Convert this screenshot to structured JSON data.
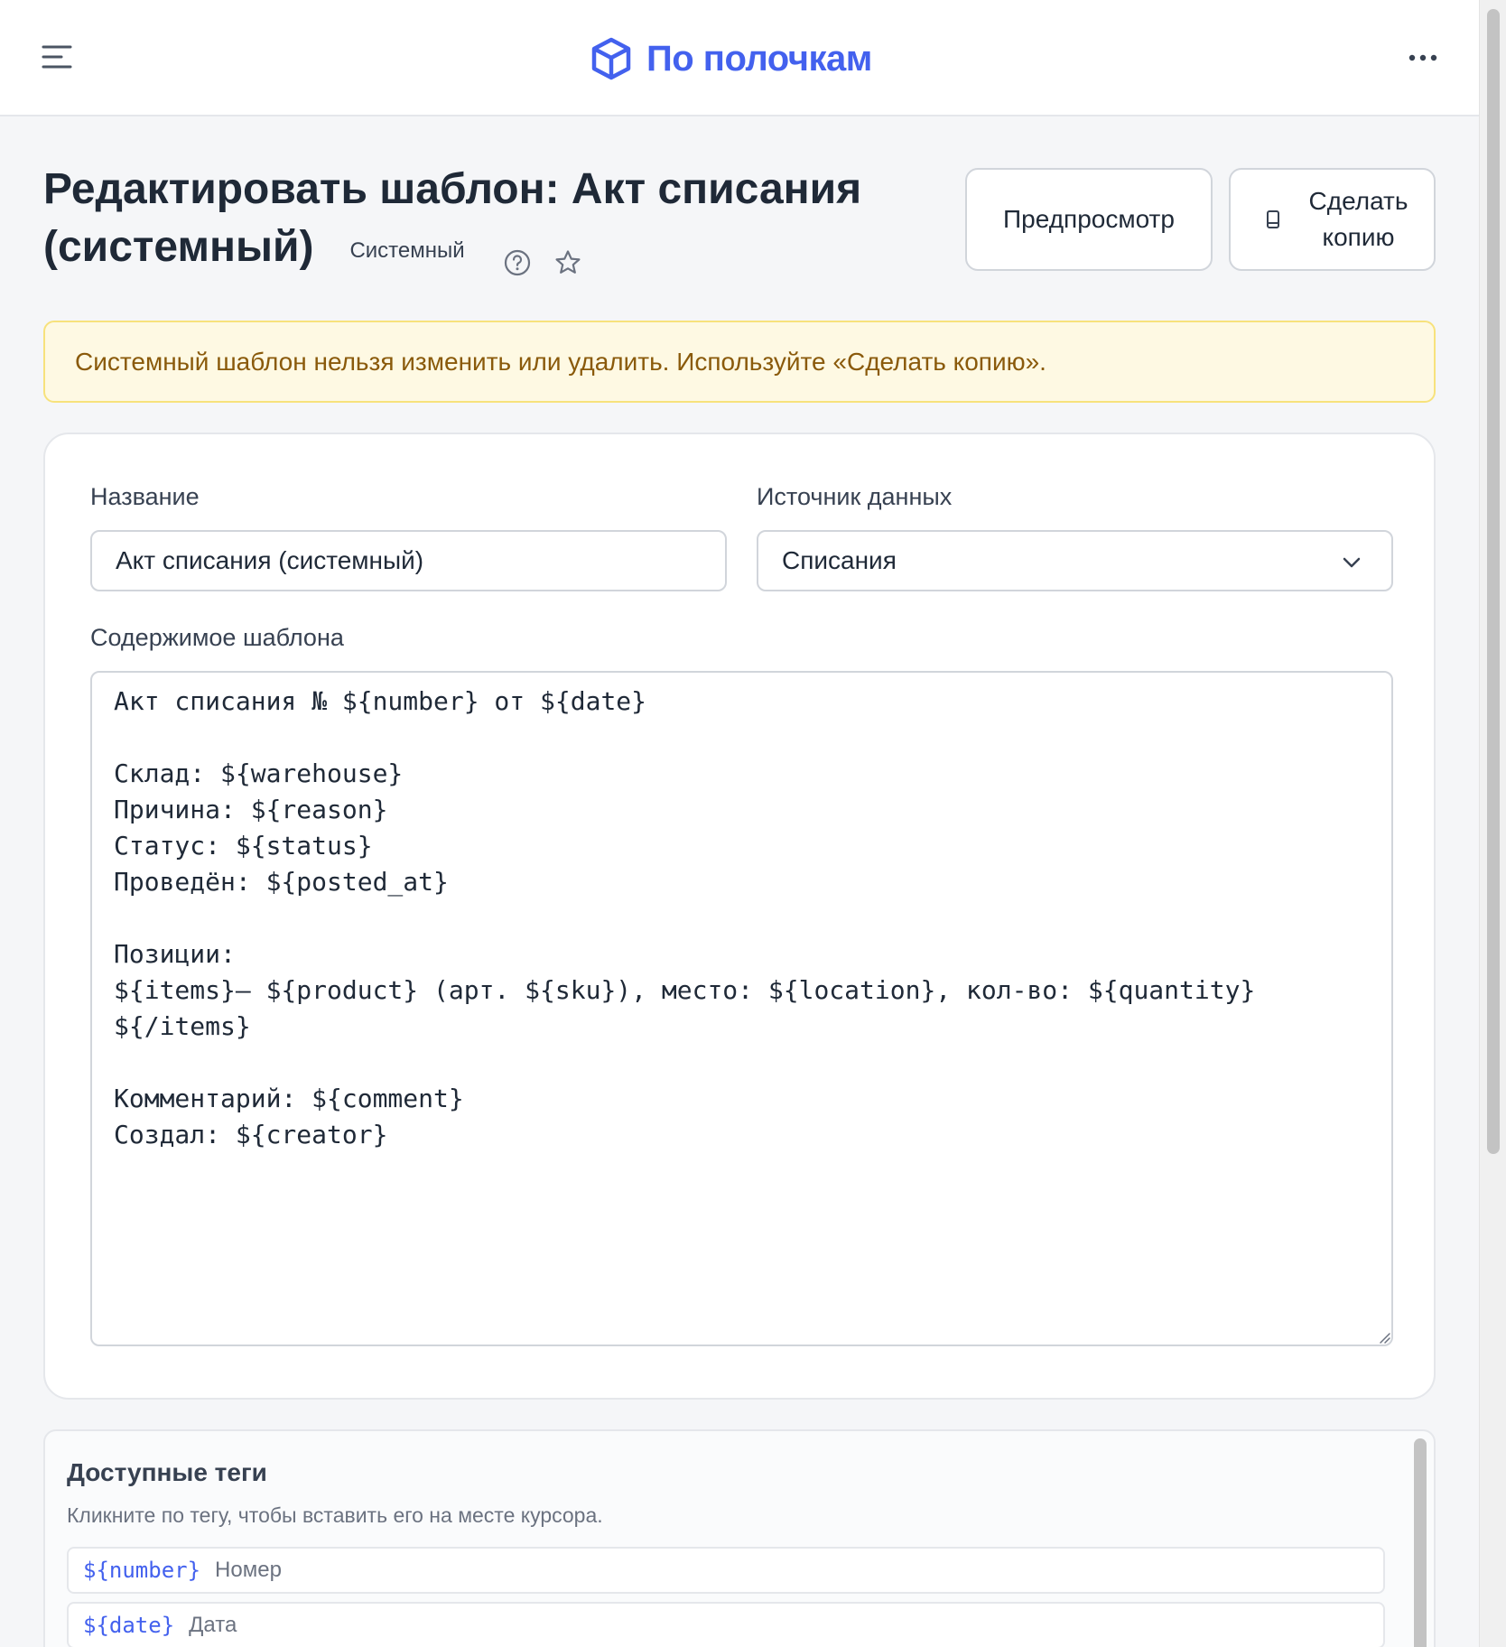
{
  "header": {
    "brand": "По полочкам",
    "brand_color": "#4361ee"
  },
  "page": {
    "title_line1": "Редактировать шаблон: Акт списания",
    "title_line2": "(системный)",
    "badge": "Системный",
    "preview_label": "Предпросмотр",
    "copy_label": "Сделать копию"
  },
  "alert": {
    "text": "Системный шаблон нельзя изменить или удалить. Используйте «Сделать копию»."
  },
  "form": {
    "name_label": "Название",
    "name_value": "Акт списания (системный)",
    "source_label": "Источник данных",
    "source_value": "Списания",
    "content_label": "Содержимое шаблона",
    "content_value": "Акт списания № ${number} от ${date}\n\nСклад: ${warehouse}\nПричина: ${reason}\nСтатус: ${status}\nПроведён: ${posted_at}\n\nПозиции:\n${items}— ${product} (арт. ${sku}), место: ${location}, кол-во: ${quantity}\n${/items}\n\nКомментарий: ${comment}\nСоздал: ${creator}"
  },
  "tags": {
    "title": "Доступные теги",
    "hint": "Кликните по тегу, чтобы вставить его на месте курсора.",
    "items": [
      {
        "code": "${number}",
        "desc": "Номер"
      },
      {
        "code": "${date}",
        "desc": "Дата"
      }
    ]
  }
}
